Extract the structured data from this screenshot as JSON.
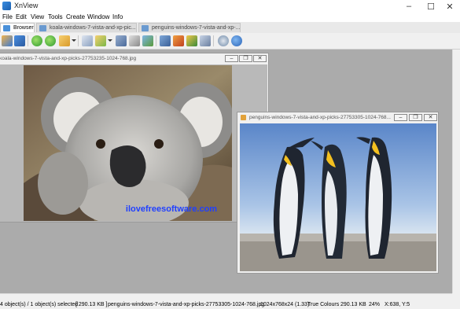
{
  "window": {
    "title": "XnView",
    "controls": {
      "minimize": "–",
      "maximize": "☐",
      "close": "✕"
    }
  },
  "menu": [
    "File",
    "Edit",
    "View",
    "Tools",
    "Create",
    "Window",
    "Info"
  ],
  "tabs": [
    {
      "label": "Browser"
    },
    {
      "label": "koala-windows-7-vista-and-xp-pic..."
    },
    {
      "label": "penguins-windows-7-vista-and-xp-..."
    }
  ],
  "toolbar_icons": [
    "browse-icon",
    "fullscreen-icon",
    "previous-icon",
    "next-icon",
    "favorites-icon",
    "copy-icon",
    "move-icon",
    "find-icon",
    "print-icon",
    "capture-icon",
    "batch-convert-icon",
    "slideshow-icon",
    "web-page-icon",
    "contact-sheet-icon",
    "settings-icon",
    "about-icon"
  ],
  "koala_window": {
    "title": "koala-windows-7-vista-and-xp-picks-27753235-1024-768.jpg",
    "watermark": "ilovefreesoftware.com"
  },
  "penguins_window": {
    "title": "penguins-windows-7-vista-and-xp-picks-27753305-1024-768..."
  },
  "child_buttons": {
    "minimize": "–",
    "restore": "❐",
    "close": "✕"
  },
  "status": {
    "objects": "4 object(s) / 1 object(s) selected",
    "selected_size": "[ 290.13 KB ]",
    "filename": "penguins-windows-7-vista-and-xp-picks-27753305-1024-768.jpg",
    "dimensions": "1024x768x24 (1.33)",
    "colours": "True Colours",
    "file_size": "290.13 KB",
    "zoom": "24%",
    "coords": "X:638, Y:5"
  }
}
